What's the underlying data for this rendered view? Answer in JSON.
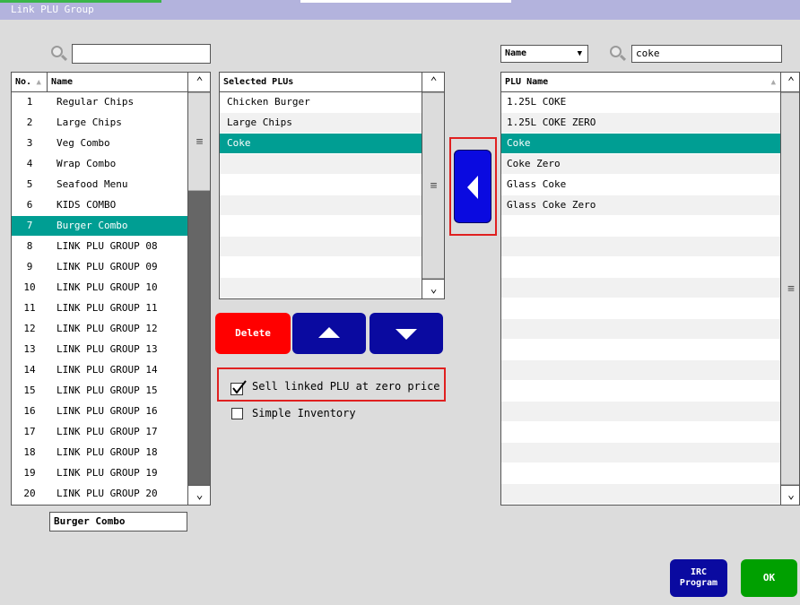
{
  "window": {
    "title": "Link PLU Group"
  },
  "group_search": {
    "value": "",
    "placeholder": ""
  },
  "group_list": {
    "headers": {
      "no": "No.",
      "name": "Name"
    },
    "rows": [
      {
        "no": "1",
        "name": "Regular Chips"
      },
      {
        "no": "2",
        "name": "Large Chips"
      },
      {
        "no": "3",
        "name": "Veg Combo"
      },
      {
        "no": "4",
        "name": "Wrap Combo"
      },
      {
        "no": "5",
        "name": "Seafood Menu"
      },
      {
        "no": "6",
        "name": "KIDS COMBO"
      },
      {
        "no": "7",
        "name": "Burger Combo"
      },
      {
        "no": "8",
        "name": "LINK PLU GROUP 08"
      },
      {
        "no": "9",
        "name": "LINK PLU GROUP 09"
      },
      {
        "no": "10",
        "name": "LINK PLU GROUP 10"
      },
      {
        "no": "11",
        "name": "LINK PLU GROUP 11"
      },
      {
        "no": "12",
        "name": "LINK PLU GROUP 12"
      },
      {
        "no": "13",
        "name": "LINK PLU GROUP 13"
      },
      {
        "no": "14",
        "name": "LINK PLU GROUP 14"
      },
      {
        "no": "15",
        "name": "LINK PLU GROUP 15"
      },
      {
        "no": "16",
        "name": "LINK PLU GROUP 16"
      },
      {
        "no": "17",
        "name": "LINK PLU GROUP 17"
      },
      {
        "no": "18",
        "name": "LINK PLU GROUP 18"
      },
      {
        "no": "19",
        "name": "LINK PLU GROUP 19"
      },
      {
        "no": "20",
        "name": "LINK PLU GROUP 20"
      }
    ],
    "selected_index": 6
  },
  "group_name": {
    "value": "Burger Combo"
  },
  "selected_plus": {
    "header": "Selected PLUs",
    "rows": [
      "Chicken Burger",
      "Large Chips",
      "Coke"
    ],
    "selected_index": 2
  },
  "buttons": {
    "delete": "Delete",
    "irc": [
      "IRC",
      "Program"
    ],
    "ok": "OK"
  },
  "options": {
    "sell_zero": {
      "label": "Sell linked PLU at zero price",
      "checked": true
    },
    "simple_inventory": {
      "label": "Simple Inventory",
      "checked": false
    }
  },
  "plu_filter": {
    "field": "Name",
    "search_value": "coke"
  },
  "plu_list": {
    "header": "PLU Name",
    "rows": [
      "1.25L COKE",
      "1.25L COKE ZERO",
      "Coke",
      "Coke Zero",
      "Glass Coke",
      "Glass Coke Zero"
    ],
    "selected_index": 2
  },
  "icons": {
    "search": "search-icon",
    "add_link": "arrow-left-icon",
    "move_up": "triangle-up-icon",
    "move_down": "triangle-down-icon",
    "scroll_up": "chevron-up-icon",
    "scroll_down": "chevron-down-icon",
    "checkmark": "checkmark-icon",
    "dropdown": "dropdown-arrow-icon",
    "sort": "sort-ascending-icon"
  },
  "colors": {
    "selection": "#009e93",
    "primary_button": "#0a0aa0",
    "delete_button": "#ff0000",
    "ok_button": "#00a000",
    "highlight_box": "#e02020",
    "title_bar": "#b3b3dd"
  }
}
